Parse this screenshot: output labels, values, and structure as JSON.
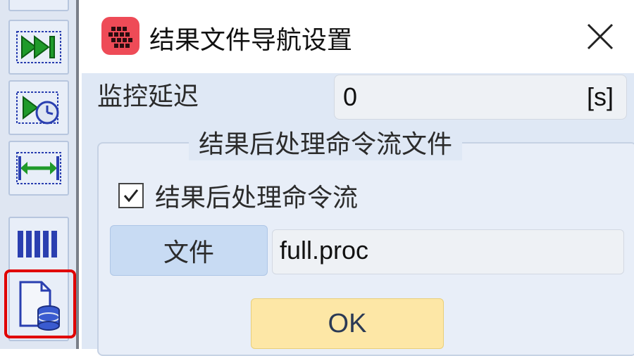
{
  "toolbar": {
    "items": [
      {
        "icon": "partial-tool-icon"
      },
      {
        "icon": "fast-forward-icon"
      },
      {
        "icon": "timed-play-icon"
      },
      {
        "icon": "resize-width-icon"
      },
      {
        "icon": "columns-icon"
      },
      {
        "icon": "file-database-icon",
        "highlighted": true
      }
    ]
  },
  "dialog": {
    "title": "结果文件导航设置",
    "monitor_delay": {
      "label": "监控延迟",
      "value": "0",
      "unit": "[s]"
    },
    "group": {
      "title": "结果后处理命令流文件",
      "checkbox_label": "结果后处理命令流",
      "checkbox_checked": true,
      "file_button_label": "文件",
      "file_value": "full.proc"
    },
    "ok_label": "OK"
  },
  "colors": {
    "app_icon": "#ee4b57",
    "dialog_bg": "#dfe8f5",
    "ok_button": "#fde7a6",
    "file_button": "#c8dbf3",
    "highlight": "#e00000"
  }
}
